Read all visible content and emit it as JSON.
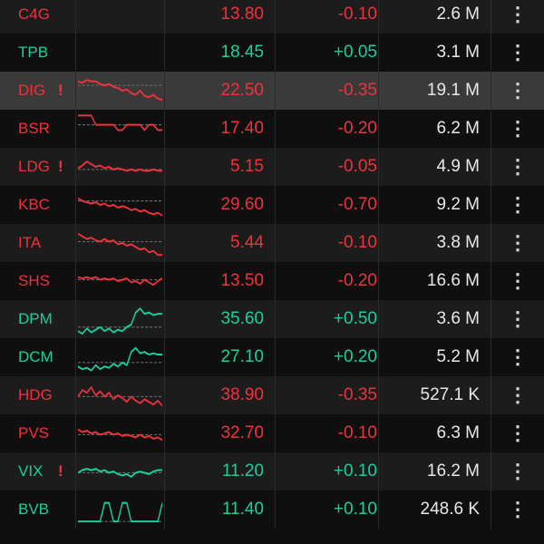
{
  "colors": {
    "up": "#19d09a",
    "down": "#f0313c",
    "background": "#0f0f0f"
  },
  "rows": [
    {
      "symbol": "C4G",
      "warning": false,
      "price": "13.80",
      "change": "-0.10",
      "volume": "2.6 M",
      "direction": "down",
      "menu_icon": "more-vertical-icon",
      "spark": []
    },
    {
      "symbol": "TPB",
      "warning": false,
      "price": "18.45",
      "change": "+0.05",
      "volume": "3.1 M",
      "direction": "up",
      "menu_icon": "more-vertical-icon",
      "spark": []
    },
    {
      "symbol": "DIG",
      "warning": true,
      "warning_mark": "!",
      "price": "22.50",
      "change": "-0.35",
      "volume": "19.1 M",
      "direction": "down",
      "selected": true,
      "menu_icon": "more-vertical-icon",
      "spark": [
        6,
        7,
        5,
        6,
        6,
        8,
        9,
        8,
        10,
        11,
        13,
        12,
        15,
        16,
        13,
        17,
        18,
        16,
        19,
        20
      ],
      "ref": 9
    },
    {
      "symbol": "BSR",
      "warning": false,
      "price": "17.40",
      "change": "-0.20",
      "volume": "6.2 M",
      "direction": "down",
      "menu_icon": "more-vertical-icon",
      "spark": [
        3,
        3,
        3,
        3,
        10,
        10,
        10,
        10,
        10,
        14,
        14,
        10,
        10,
        10,
        10,
        14,
        10,
        10,
        14,
        14
      ],
      "ref": 10
    },
    {
      "symbol": "LDG",
      "warning": true,
      "warning_mark": "!",
      "price": "5.15",
      "change": "-0.05",
      "volume": "4.9 M",
      "direction": "down",
      "menu_icon": "more-vertical-icon",
      "spark": [
        14,
        12,
        9,
        11,
        13,
        12,
        14,
        13,
        15,
        14,
        15,
        16,
        15,
        16,
        15,
        16,
        16,
        15,
        16,
        16
      ],
      "ref": 15
    },
    {
      "symbol": "KBC",
      "warning": false,
      "price": "29.60",
      "change": "-0.70",
      "volume": "9.2 M",
      "direction": "down",
      "menu_icon": "more-vertical-icon",
      "spark": [
        8,
        10,
        11,
        12,
        11,
        13,
        12,
        14,
        13,
        15,
        14,
        15,
        17,
        16,
        18,
        17,
        19,
        20,
        19,
        21
      ],
      "ref": 10
    },
    {
      "symbol": "ITA",
      "warning": false,
      "price": "5.44",
      "change": "-0.10",
      "volume": "3.8 M",
      "direction": "down",
      "menu_icon": "more-vertical-icon",
      "spark": [
        6,
        8,
        10,
        9,
        11,
        12,
        10,
        12,
        11,
        14,
        13,
        15,
        14,
        16,
        18,
        17,
        20,
        19,
        22,
        22
      ],
      "ref": 12
    },
    {
      "symbol": "SHS",
      "warning": false,
      "price": "13.50",
      "change": "-0.20",
      "volume": "16.6 M",
      "direction": "down",
      "menu_icon": "more-vertical-icon",
      "spark": [
        10,
        11,
        10,
        11,
        10,
        12,
        11,
        12,
        11,
        13,
        12,
        11,
        14,
        13,
        15,
        12,
        14,
        16,
        13,
        11
      ],
      "ref": 12
    },
    {
      "symbol": "DPM",
      "warning": false,
      "price": "35.60",
      "change": "+0.50",
      "volume": "3.6 M",
      "direction": "up",
      "menu_icon": "more-vertical-icon",
      "spark": [
        22,
        24,
        20,
        23,
        21,
        19,
        22,
        20,
        23,
        21,
        22,
        19,
        17,
        8,
        5,
        9,
        8,
        10,
        9,
        9
      ],
      "ref": 19
    },
    {
      "symbol": "DCM",
      "warning": false,
      "price": "27.10",
      "change": "+0.20",
      "volume": "5.2 M",
      "direction": "up",
      "menu_icon": "more-vertical-icon",
      "spark": [
        20,
        22,
        21,
        23,
        19,
        22,
        20,
        21,
        18,
        20,
        17,
        19,
        9,
        6,
        10,
        9,
        11,
        10,
        11,
        11
      ],
      "ref": 17
    },
    {
      "symbol": "HDG",
      "warning": false,
      "price": "38.90",
      "change": "-0.35",
      "volume": "527.1 K",
      "direction": "down",
      "menu_icon": "more-vertical-icon",
      "spark": [
        14,
        9,
        11,
        7,
        13,
        10,
        14,
        11,
        16,
        13,
        15,
        18,
        14,
        17,
        19,
        16,
        18,
        20,
        17,
        21
      ],
      "ref": 14
    },
    {
      "symbol": "PVS",
      "warning": false,
      "price": "32.70",
      "change": "-0.10",
      "volume": "6.3 M",
      "direction": "down",
      "menu_icon": "more-vertical-icon",
      "spark": [
        10,
        12,
        11,
        13,
        12,
        14,
        13,
        12,
        14,
        13,
        15,
        14,
        15,
        16,
        14,
        16,
        15,
        17,
        16,
        18
      ],
      "ref": 14
    },
    {
      "symbol": "VIX",
      "warning": true,
      "warning_mark": "!",
      "price": "11.20",
      "change": "+0.10",
      "volume": "16.2 M",
      "direction": "up",
      "menu_icon": "more-vertical-icon",
      "spark": [
        14,
        12,
        11,
        12,
        11,
        13,
        12,
        14,
        13,
        15,
        16,
        15,
        17,
        14,
        13,
        14,
        15,
        13,
        12,
        12
      ],
      "ref": 14
    },
    {
      "symbol": "BVB",
      "warning": false,
      "price": "11.40",
      "change": "+0.10",
      "volume": "248.6 K",
      "direction": "up",
      "menu_icon": "more-vertical-icon",
      "spark": [
        22,
        22,
        22,
        22,
        22,
        22,
        8,
        8,
        22,
        22,
        8,
        8,
        22,
        22,
        22,
        22,
        22,
        22,
        22,
        8
      ],
      "ref": 22
    }
  ]
}
